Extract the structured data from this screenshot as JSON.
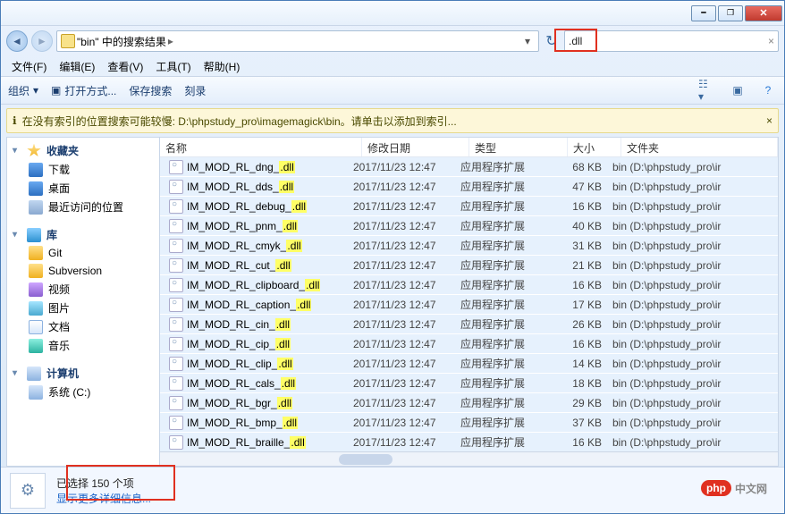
{
  "nav": {
    "breadcrumb_text": "\"bin\" 中的搜索结果",
    "search_term": ".dll",
    "refresh_icon": "↻",
    "dropdown": "▾"
  },
  "menu": {
    "file": "文件(F)",
    "edit": "编辑(E)",
    "view": "查看(V)",
    "tools": "工具(T)",
    "help": "帮助(H)"
  },
  "toolbar": {
    "organize": "组织",
    "open_with": "打开方式...",
    "save_search": "保存搜索",
    "burn": "刻录"
  },
  "info": "在没有索引的位置搜索可能较慢: D:\\phpstudy_pro\\imagemagick\\bin。请单击以添加到索引...",
  "sidebar": {
    "favorites": "收藏夹",
    "fav_items": {
      "downloads": "下载",
      "desktop": "桌面",
      "recent": "最近访问的位置"
    },
    "libraries": "库",
    "lib_items": {
      "git": "Git",
      "svn": "Subversion",
      "video": "视频",
      "pictures": "图片",
      "documents": "文档",
      "music": "音乐"
    },
    "computer": "计算机",
    "comp_items": {
      "c": "系统 (C:)"
    }
  },
  "headers": {
    "name": "名称",
    "date": "修改日期",
    "type": "类型",
    "size": "大小",
    "folder": "文件夹"
  },
  "rows": [
    {
      "name_prefix": "IM_MOD_RL_dng_",
      "ext": ".dll",
      "date": "2017/11/23 12:47",
      "type": "应用程序扩展",
      "size": "68 KB",
      "folder": "bin (D:\\phpstudy_pro\\ir"
    },
    {
      "name_prefix": "IM_MOD_RL_dds_",
      "ext": ".dll",
      "date": "2017/11/23 12:47",
      "type": "应用程序扩展",
      "size": "47 KB",
      "folder": "bin (D:\\phpstudy_pro\\ir"
    },
    {
      "name_prefix": "IM_MOD_RL_debug_",
      "ext": ".dll",
      "date": "2017/11/23 12:47",
      "type": "应用程序扩展",
      "size": "16 KB",
      "folder": "bin (D:\\phpstudy_pro\\ir"
    },
    {
      "name_prefix": "IM_MOD_RL_pnm_",
      "ext": ".dll",
      "date": "2017/11/23 12:47",
      "type": "应用程序扩展",
      "size": "40 KB",
      "folder": "bin (D:\\phpstudy_pro\\ir"
    },
    {
      "name_prefix": "IM_MOD_RL_cmyk_",
      "ext": ".dll",
      "date": "2017/11/23 12:47",
      "type": "应用程序扩展",
      "size": "31 KB",
      "folder": "bin (D:\\phpstudy_pro\\ir"
    },
    {
      "name_prefix": "IM_MOD_RL_cut_",
      "ext": ".dll",
      "date": "2017/11/23 12:47",
      "type": "应用程序扩展",
      "size": "21 KB",
      "folder": "bin (D:\\phpstudy_pro\\ir"
    },
    {
      "name_prefix": "IM_MOD_RL_clipboard_",
      "ext": ".dll",
      "date": "2017/11/23 12:47",
      "type": "应用程序扩展",
      "size": "16 KB",
      "folder": "bin (D:\\phpstudy_pro\\ir"
    },
    {
      "name_prefix": "IM_MOD_RL_caption_",
      "ext": ".dll",
      "date": "2017/11/23 12:47",
      "type": "应用程序扩展",
      "size": "17 KB",
      "folder": "bin (D:\\phpstudy_pro\\ir"
    },
    {
      "name_prefix": "IM_MOD_RL_cin_",
      "ext": ".dll",
      "date": "2017/11/23 12:47",
      "type": "应用程序扩展",
      "size": "26 KB",
      "folder": "bin (D:\\phpstudy_pro\\ir"
    },
    {
      "name_prefix": "IM_MOD_RL_cip_",
      "ext": ".dll",
      "date": "2017/11/23 12:47",
      "type": "应用程序扩展",
      "size": "16 KB",
      "folder": "bin (D:\\phpstudy_pro\\ir"
    },
    {
      "name_prefix": "IM_MOD_RL_clip_",
      "ext": ".dll",
      "date": "2017/11/23 12:47",
      "type": "应用程序扩展",
      "size": "14 KB",
      "folder": "bin (D:\\phpstudy_pro\\ir"
    },
    {
      "name_prefix": "IM_MOD_RL_cals_",
      "ext": ".dll",
      "date": "2017/11/23 12:47",
      "type": "应用程序扩展",
      "size": "18 KB",
      "folder": "bin (D:\\phpstudy_pro\\ir"
    },
    {
      "name_prefix": "IM_MOD_RL_bgr_",
      "ext": ".dll",
      "date": "2017/11/23 12:47",
      "type": "应用程序扩展",
      "size": "29 KB",
      "folder": "bin (D:\\phpstudy_pro\\ir"
    },
    {
      "name_prefix": "IM_MOD_RL_bmp_",
      "ext": ".dll",
      "date": "2017/11/23 12:47",
      "type": "应用程序扩展",
      "size": "37 KB",
      "folder": "bin (D:\\phpstudy_pro\\ir"
    },
    {
      "name_prefix": "IM_MOD_RL_braille_",
      "ext": ".dll",
      "date": "2017/11/23 12:47",
      "type": "应用程序扩展",
      "size": "16 KB",
      "folder": "bin (D:\\phpstudy_pro\\ir"
    }
  ],
  "status": {
    "line1": "已选择 150 个项",
    "line2": "显示更多详细信息..."
  },
  "watermark": {
    "badge": "php",
    "text": "中文网"
  }
}
